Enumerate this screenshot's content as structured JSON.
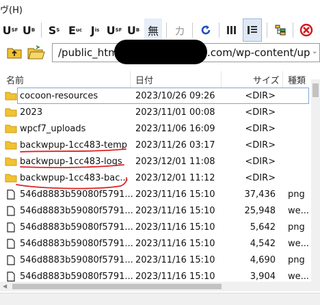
{
  "menu": {
    "help_label": "ヴ(H)"
  },
  "toolbar": {
    "buttons": [
      {
        "main": "U",
        "sup": "SF"
      },
      {
        "main": "U",
        "sup": "B"
      },
      {
        "main": "S",
        "sup": "S"
      },
      {
        "main": "E",
        "sup": "uc"
      },
      {
        "main": "J",
        "sup": "is"
      },
      {
        "main": "U",
        "sup": "SF"
      },
      {
        "main": "U",
        "sup": "B"
      },
      {
        "main": "無",
        "sup": ""
      },
      {
        "main": "カ",
        "sup": ""
      }
    ]
  },
  "path": {
    "prefix": "/public_html",
    "suffix": ".com/wp-content/up"
  },
  "columns": {
    "name": "名前",
    "date": "日付",
    "size": "サイズ",
    "type": "種類"
  },
  "rows": [
    {
      "name": "cocoon-resources",
      "date": "2023/10/26 09:26",
      "size": "<DIR>",
      "type": "",
      "kind": "folder"
    },
    {
      "name": "2023",
      "date": "2023/11/01 00:08",
      "size": "<DIR>",
      "type": "",
      "kind": "folder"
    },
    {
      "name": "wpcf7_uploads",
      "date": "2023/11/06 16:09",
      "size": "<DIR>",
      "type": "",
      "kind": "folder"
    },
    {
      "name": "backwpup-1cc483-temp",
      "date": "2023/11/26 03:17",
      "size": "<DIR>",
      "type": "",
      "kind": "folder"
    },
    {
      "name": "backwpup-1cc483-logs",
      "date": "2023/12/01 11:08",
      "size": "<DIR>",
      "type": "",
      "kind": "folder"
    },
    {
      "name": "backwpup-1cc483-bac...",
      "date": "2023/12/01 11:12",
      "size": "<DIR>",
      "type": "",
      "kind": "folder"
    },
    {
      "name": "546d8883b59080f5791...",
      "date": "2023/11/16 15:10",
      "size": "37,436",
      "type": "png",
      "kind": "file"
    },
    {
      "name": "546d8883b59080f5791...",
      "date": "2023/11/16 15:10",
      "size": "25,948",
      "type": "we...",
      "kind": "file"
    },
    {
      "name": "546d8883b59080f5791...",
      "date": "2023/11/16 15:10",
      "size": "5,642",
      "type": "png",
      "kind": "file"
    },
    {
      "name": "546d8883b59080f5791...",
      "date": "2023/11/16 15:10",
      "size": "4,542",
      "type": "we...",
      "kind": "file"
    },
    {
      "name": "546d8883b59080f5791...",
      "date": "2023/11/16 15:10",
      "size": "4,690",
      "type": "png",
      "kind": "file"
    },
    {
      "name": "546d8883b59080f5791...",
      "date": "2023/11/16 15:10",
      "size": "3,904",
      "type": "we...",
      "kind": "file"
    }
  ],
  "colors": {
    "folder": "#f2c230",
    "folder_edge": "#c99a10",
    "annotation": "#e02020",
    "selection": "#7aa7d6"
  }
}
